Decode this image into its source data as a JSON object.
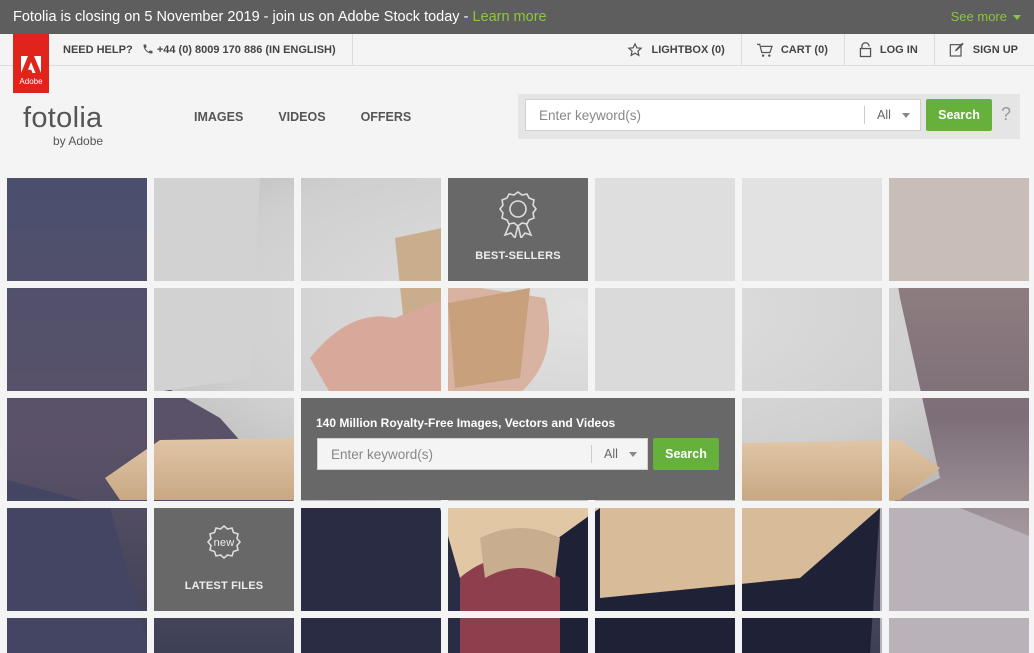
{
  "announcement": {
    "text": "Fotolia is closing on 5 November 2019 - join us on Adobe Stock today - ",
    "link": "Learn more",
    "see_more": "See more"
  },
  "adobe_badge": {
    "label": "Adobe"
  },
  "utility": {
    "help_label": "NEED HELP?",
    "phone": "+44 (0) 8009 170 886 (IN ENGLISH)",
    "lightbox": "LIGHTBOX (0)",
    "cart": "CART (0)",
    "login": "LOG IN",
    "signup": "SIGN UP"
  },
  "logo": {
    "wordmark": "fotolia",
    "byline": "by Adobe"
  },
  "nav": {
    "images": "IMAGES",
    "videos": "VIDEOS",
    "offers": "OFFERS"
  },
  "search_top": {
    "placeholder": "Enter keyword(s)",
    "filter": "All",
    "button": "Search",
    "help": "?"
  },
  "mosaic": {
    "best_sellers": "BEST-SELLERS",
    "latest_files": "LATEST FILES",
    "new_badge": "new",
    "center_title": "140 Million Royalty-Free Images, Vectors and Videos",
    "center_placeholder": "Enter keyword(s)",
    "center_filter": "All",
    "center_button": "Search"
  },
  "colors": {
    "brand_green": "#65b13c",
    "link_green": "#8cc63f",
    "adobe_red": "#e0231b",
    "tile_gray": "#686868"
  }
}
